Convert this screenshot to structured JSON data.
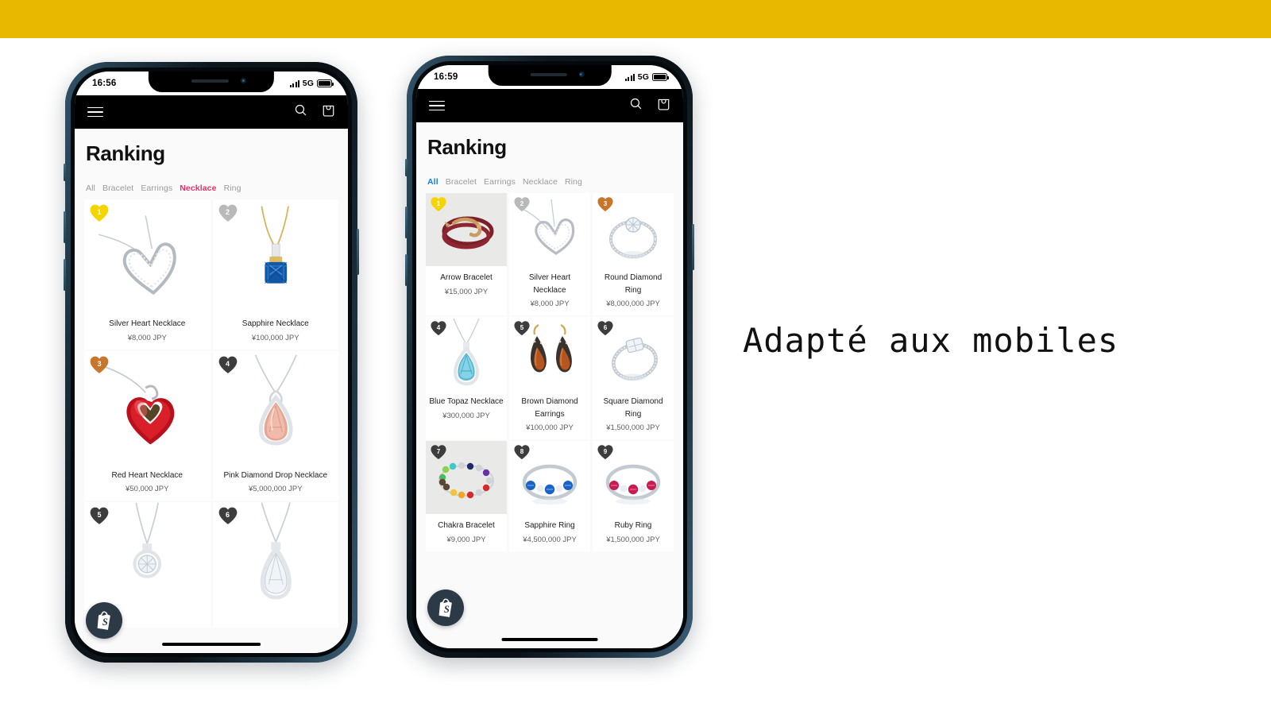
{
  "banner": {
    "color": "#E8B800"
  },
  "tagline": "Adapté aux mobiles",
  "phones": [
    {
      "id": "phone-left",
      "status": {
        "time": "16:56",
        "network": "5G"
      },
      "appbar": {
        "menu_icon": "hamburger-icon",
        "search_icon": "search-icon",
        "cart_icon": "shopping-bag-icon"
      },
      "page_title": "Ranking",
      "tabs": [
        {
          "label": "All",
          "active": false
        },
        {
          "label": "Bracelet",
          "active": false
        },
        {
          "label": "Earrings",
          "active": false
        },
        {
          "label": "Necklace",
          "active": true
        },
        {
          "label": "Ring",
          "active": false
        }
      ],
      "active_tab_color": "#EE2D69",
      "columns": 2,
      "products": [
        {
          "rank": 1,
          "name": "Silver Heart Necklace",
          "price": "¥8,000 JPY",
          "badge_color": "#F5D400",
          "art": "silver-heart-necklace"
        },
        {
          "rank": 2,
          "name": "Sapphire Necklace",
          "price": "¥100,000 JPY",
          "badge_color": "#B9B9B9",
          "art": "sapphire-necklace"
        },
        {
          "rank": 3,
          "name": "Red Heart Necklace",
          "price": "¥50,000 JPY",
          "badge_color": "#C8762B",
          "art": "red-heart-necklace"
        },
        {
          "rank": 4,
          "name": "Pink Diamond Drop Necklace",
          "price": "¥5,000,000 JPY",
          "badge_color": "#3D3D3D",
          "art": "pink-drop-necklace"
        },
        {
          "rank": 5,
          "name": "",
          "price": "",
          "badge_color": "#3D3D3D",
          "art": "round-diamond-necklace"
        },
        {
          "rank": 6,
          "name": "",
          "price": "",
          "badge_color": "#3D3D3D",
          "art": "pear-diamond-necklace"
        }
      ]
    },
    {
      "id": "phone-right",
      "status": {
        "time": "16:59",
        "network": "5G"
      },
      "appbar": {
        "menu_icon": "hamburger-icon",
        "search_icon": "search-icon",
        "cart_icon": "shopping-bag-icon"
      },
      "page_title": "Ranking",
      "tabs": [
        {
          "label": "All",
          "active": true
        },
        {
          "label": "Bracelet",
          "active": false
        },
        {
          "label": "Earrings",
          "active": false
        },
        {
          "label": "Necklace",
          "active": false
        },
        {
          "label": "Ring",
          "active": false
        }
      ],
      "active_tab_color": "#1C7BE0",
      "columns": 3,
      "products": [
        {
          "rank": 1,
          "name": "Arrow Bracelet",
          "price": "¥15,000 JPY",
          "badge_color": "#F5D400",
          "art": "arrow-bracelet",
          "grey": true
        },
        {
          "rank": 2,
          "name": "Silver Heart Necklace",
          "price": "¥8,000 JPY",
          "badge_color": "#B9B9B9",
          "art": "silver-heart-necklace"
        },
        {
          "rank": 3,
          "name": "Round Diamond Ring",
          "price": "¥8,000,000 JPY",
          "badge_color": "#C8762B",
          "art": "round-diamond-ring"
        },
        {
          "rank": 4,
          "name": "Blue Topaz Necklace",
          "price": "¥300,000 JPY",
          "badge_color": "#3D3D3D",
          "art": "blue-topaz-necklace"
        },
        {
          "rank": 5,
          "name": "Brown Diamond Earrings",
          "price": "¥100,000 JPY",
          "badge_color": "#3D3D3D",
          "art": "brown-diamond-earrings"
        },
        {
          "rank": 6,
          "name": "Square Diamond Ring",
          "price": "¥1,500,000 JPY",
          "badge_color": "#3D3D3D",
          "art": "square-diamond-ring"
        },
        {
          "rank": 7,
          "name": "Chakra Bracelet",
          "price": "¥9,000 JPY",
          "badge_color": "#3D3D3D",
          "art": "chakra-bracelet",
          "grey": true
        },
        {
          "rank": 8,
          "name": "Sapphire Ring",
          "price": "¥4,500,000 JPY",
          "badge_color": "#3D3D3D",
          "art": "sapphire-ring"
        },
        {
          "rank": 9,
          "name": "Ruby Ring",
          "price": "¥1,500,000 JPY",
          "badge_color": "#3D3D3D",
          "art": "ruby-ring"
        }
      ]
    }
  ]
}
